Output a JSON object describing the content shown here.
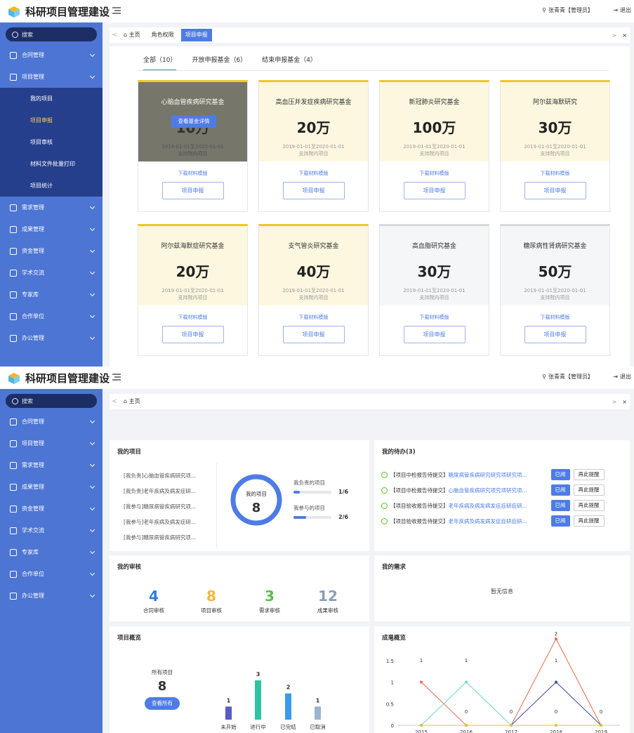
{
  "app": {
    "title": "科研项目管理建设",
    "user": "张青青【管理员】",
    "logout": "退出"
  },
  "search_label": "搜索",
  "screen1": {
    "menu_top": [
      "合同管理",
      "项目管理"
    ],
    "submenu": [
      "我的项目",
      "项目申报",
      "项目审核",
      "材料文件批量打印",
      "项目统计"
    ],
    "submenu_active": 1,
    "menu_bottom": [
      "需求管理",
      "成果管理",
      "资金管理",
      "学术交流",
      "专家库",
      "合作单位",
      "办公管理"
    ],
    "tabs": [
      "主页",
      "角色权限",
      "项目申报"
    ],
    "tab_active": 2,
    "filters": [
      "全部（10）",
      "开放申报基金（6）",
      "结束申报基金（4）"
    ],
    "cards": [
      {
        "name": "心脑血管疾病研究基金",
        "amount": "10万",
        "date": "2019-01-01至2020-01-01",
        "scope": "支持院内项目",
        "hover": true,
        "view": "查看基金详情"
      },
      {
        "name": "高血压并发症疾病研究基金",
        "amount": "20万",
        "date": "2019-01-01至2020-01-01",
        "scope": "支持院内项目"
      },
      {
        "name": "新冠肺炎研究基金",
        "amount": "100万",
        "date": "2019-01-01至2020-01-01",
        "scope": "支持院内项目"
      },
      {
        "name": "阿尔兹海默研究",
        "amount": "30万",
        "date": "2019-01-01至2020-01-01",
        "scope": "支持院内项目"
      },
      {
        "name": "阿尔兹海默症研究基金",
        "amount": "20万",
        "date": "2019-01-01至2020-01-01",
        "scope": "支持院内项目"
      },
      {
        "name": "支气管炎研究基金",
        "amount": "40万",
        "date": "2019-01-01至2020-01-01",
        "scope": "支持院内项目"
      },
      {
        "name": "高血脂研究基金",
        "amount": "30万",
        "date": "2019-01-01至2020-01-01",
        "scope": "支持院内项目",
        "closed": true
      },
      {
        "name": "糖尿病性肾病研究基金",
        "amount": "50万",
        "date": "2019-01-01至2020-01-01",
        "scope": "支持院内项目",
        "closed": true
      }
    ],
    "download_label": "下载材料模版",
    "apply_label": "项目申报"
  },
  "screen2": {
    "menu": [
      "合同管理",
      "项目管理",
      "需求管理",
      "成果管理",
      "资金管理",
      "学术交流",
      "专家库",
      "合作单位",
      "办公管理"
    ],
    "tabs": [
      "主页"
    ],
    "my_projects": {
      "title": "我的项目",
      "list": [
        "[我负责]心脑血管疾病研究项...",
        "[我负责]老年疾病及病发症研...",
        "[我参与]糖尿病管疾病研究项...",
        "[我参与]老年疾病及病发症研...",
        "[我参与]糖尿病管疾病研究项..."
      ],
      "ring_label": "我的项目",
      "ring_value": "8",
      "lead_label": "我负责的项目",
      "lead_frac": "1/6",
      "lead_ratio": 0.1667,
      "part_label": "我参与的项目",
      "part_frac": "2/6",
      "part_ratio": 0.3333
    },
    "todo": {
      "title": "我的待办(3)",
      "items": [
        {
          "tag": "【项目中检报告待提交】",
          "text": "糖尿病管疾病研究研究项研究项..."
        },
        {
          "tag": "【项目中检报告待提交】",
          "text": "心脑血管疾病研究项究项研究项..."
        },
        {
          "tag": "【项目验收报告待提交】",
          "text": "老年疾病及病发病发症症研症研..."
        },
        {
          "tag": "【项目验收报告待提交】",
          "text": "老年疾病及病发病发症症研症研..."
        }
      ],
      "read_label": "已阅",
      "remind_label": "再此提醒"
    },
    "review": {
      "title": "我的审核",
      "items": [
        {
          "value": "4",
          "label": "合同审核",
          "color": "#2f7de1"
        },
        {
          "value": "8",
          "label": "项目审核",
          "color": "#f5b73b"
        },
        {
          "value": "3",
          "label": "需求审核",
          "color": "#59c04a"
        },
        {
          "value": "12",
          "label": "成果审核",
          "color": "#8c9eb7"
        }
      ]
    },
    "needs": {
      "title": "我的需求",
      "empty": "暂无信息"
    },
    "overview": {
      "title": "项目概览",
      "all_label": "所有项目",
      "all_value": "8",
      "view_all": "查看所有"
    },
    "results": {
      "title": "成果概览"
    }
  },
  "chart_data": [
    {
      "type": "bar",
      "title": "项目概览",
      "categories": [
        "未开始",
        "进行中",
        "已完结",
        "已取消"
      ],
      "values": [
        1,
        3,
        2,
        1
      ],
      "colors": [
        "#5a5bc4",
        "#2ec4a0",
        "#3a9aef",
        "#9db4cf"
      ],
      "ylim": [
        0,
        3
      ]
    },
    {
      "type": "line",
      "title": "成果概览",
      "x": [
        "2015",
        "2016",
        "2017",
        "2018",
        "2019"
      ],
      "yticks": [
        "2",
        "1.5",
        "1",
        "0.5",
        "0"
      ],
      "ylim": [
        0,
        2
      ],
      "series": [
        {
          "color": "#e86b4b",
          "values": [
            1,
            0,
            0,
            2,
            0
          ]
        },
        {
          "color": "#6ad9c8",
          "values": [
            0,
            1,
            0,
            0,
            0
          ]
        },
        {
          "color": "#3d4a9c",
          "values": [
            0,
            0,
            0,
            1,
            0
          ]
        },
        {
          "color": "#e6c33d",
          "values": [
            0,
            0,
            0,
            0,
            0
          ]
        }
      ],
      "point_labels": [
        "1",
        "1",
        "0",
        "0",
        "0",
        "0",
        "2",
        "1",
        "0",
        "0"
      ]
    }
  ]
}
